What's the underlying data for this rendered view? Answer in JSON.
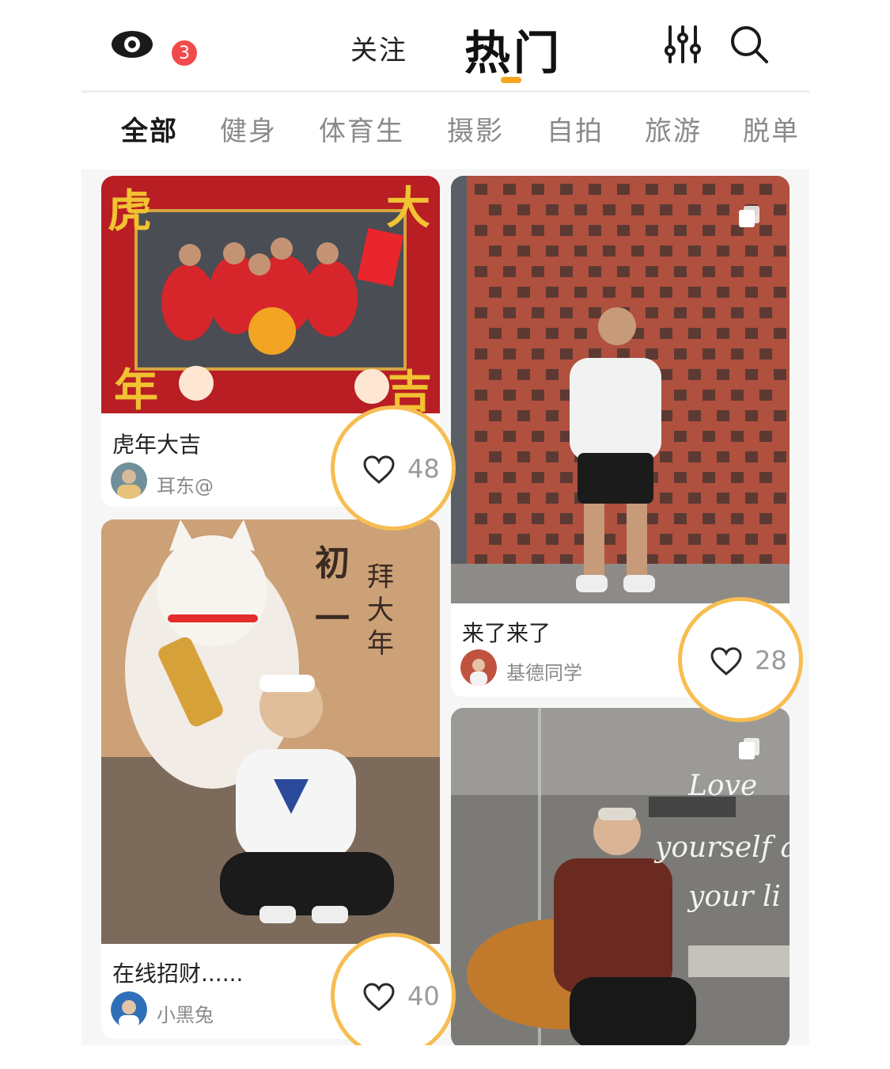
{
  "header": {
    "notification_count": "3",
    "tabs": [
      {
        "label": "关注"
      },
      {
        "label": "热门"
      }
    ],
    "accent_color": "#f5a623",
    "badge_color": "#f24a4a"
  },
  "categories": [
    {
      "label": "全部",
      "active": true
    },
    {
      "label": "健身"
    },
    {
      "label": "体育生"
    },
    {
      "label": "摄影"
    },
    {
      "label": "自拍"
    },
    {
      "label": "旅游"
    },
    {
      "label": "脱单"
    }
  ],
  "posts": [
    {
      "title": "虎年大吉",
      "author": "耳东@",
      "likes": "48"
    },
    {
      "title": "来了来了",
      "author": "基德同学",
      "likes": "28"
    },
    {
      "title": "在线招财......",
      "author": "小黑兔",
      "likes": "40"
    },
    {
      "title": "",
      "author": "",
      "likes": ""
    }
  ],
  "icons": {
    "notifications": "eye-icon",
    "filter": "sliders-icon",
    "search": "search-icon",
    "like": "heart-icon",
    "multi_image": "stack-icon"
  },
  "highlight_color": "#f7bd50"
}
